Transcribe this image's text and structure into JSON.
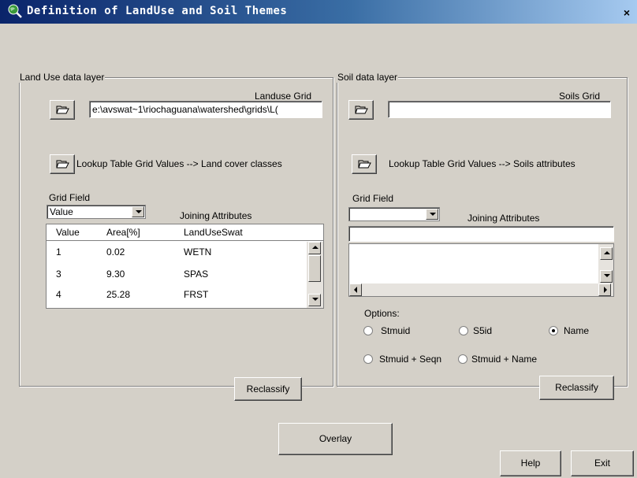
{
  "window": {
    "title": "Definition of LandUse and Soil Themes",
    "close_glyph": "×"
  },
  "landuse": {
    "legend": "Land Use data layer",
    "grid_label": "Landuse Grid",
    "grid_path": "e:\\avswat~1\\riochaguana\\watershed\\grids\\L(",
    "lookup_label": "Lookup Table  Grid Values --> Land cover classes",
    "grid_field_label": "Grid Field",
    "grid_field_value": "Value",
    "joining_label": "Joining Attributes",
    "columns": [
      "Value",
      "Area[%]",
      "LandUseSwat"
    ],
    "rows": [
      [
        "1",
        "0.02",
        "WETN"
      ],
      [
        "3",
        "9.30",
        "SPAS"
      ],
      [
        "4",
        "25.28",
        "FRST"
      ]
    ],
    "reclassify": "Reclassify"
  },
  "soil": {
    "legend": "Soil data layer",
    "grid_label": "Soils Grid",
    "grid_path": "",
    "lookup_label": "Lookup Table  Grid Values --> Soils attributes",
    "grid_field_label": "Grid Field",
    "grid_field_value": "",
    "joining_label": "Joining Attributes",
    "options_label": "Options:",
    "options": [
      {
        "label": "Stmuid",
        "selected": false
      },
      {
        "label": "S5id",
        "selected": false
      },
      {
        "label": "Name",
        "selected": true
      },
      {
        "label": "Stmuid + Seqn",
        "selected": false
      },
      {
        "label": "Stmuid + Name",
        "selected": false
      }
    ],
    "reclassify": "Reclassify"
  },
  "footer": {
    "overlay": "Overlay",
    "help": "Help",
    "exit": "Exit"
  },
  "icons": {
    "app": "globe-magnifier-icon",
    "folder": "open-folder-icon"
  },
  "colors": {
    "titlebar_start": "#0a246a",
    "titlebar_end": "#a6caf0",
    "face": "#d4d0c8"
  }
}
